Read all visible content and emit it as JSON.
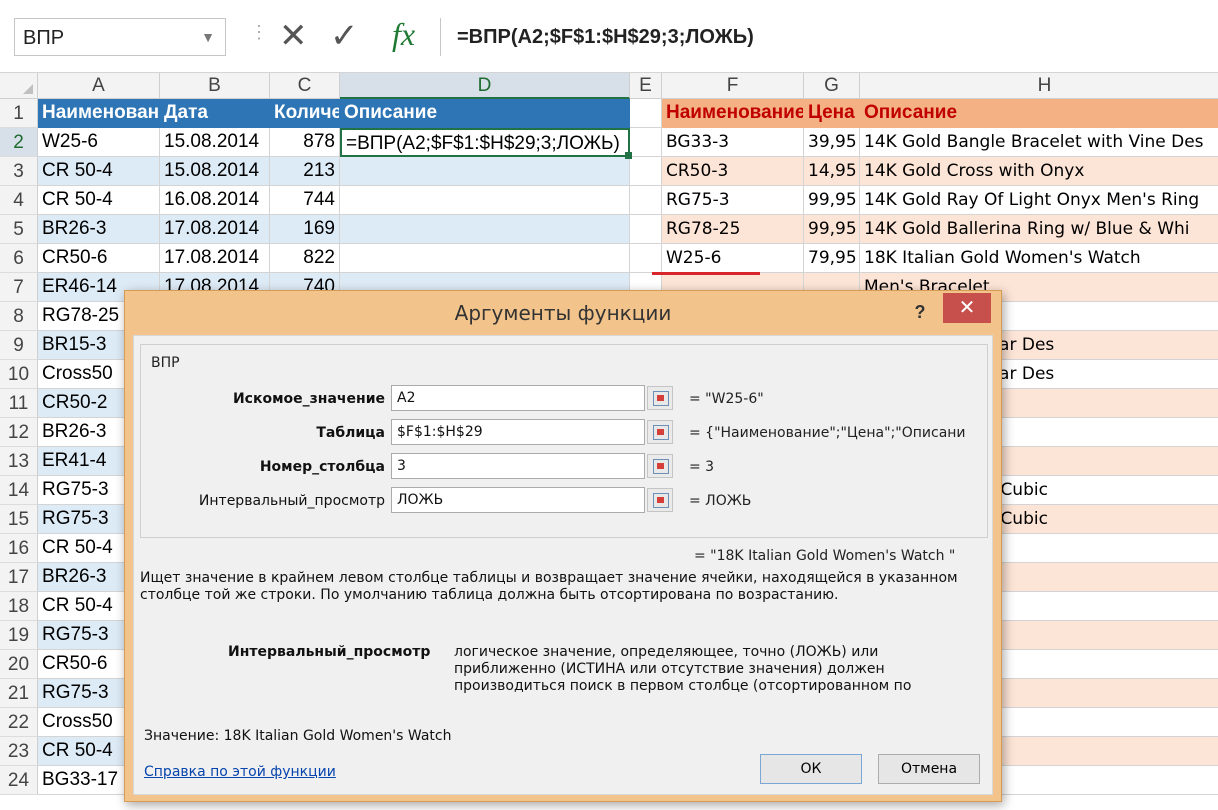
{
  "formula_bar": {
    "name_box": "ВПР",
    "cancel_icon": "✕",
    "enter_icon": "✓",
    "fx_label": "fx",
    "formula": "=ВПР(A2;$F$1:$H$29;3;ЛОЖЬ)"
  },
  "columns": [
    "A",
    "B",
    "C",
    "D",
    "E",
    "F",
    "G",
    "H"
  ],
  "rows": [
    {
      "n": "1",
      "a": "Наименование",
      "b": "Дата",
      "c": "Количество",
      "d": "Описание",
      "f": "Наименование",
      "g": "Цена",
      "h": "Описание"
    },
    {
      "n": "2",
      "a": "W25-6",
      "b": "15.08.2014",
      "c": "878",
      "d": "=ВПР(A2;$F$1:$H$29;3;ЛОЖЬ)",
      "f": "BG33-3",
      "g": "39,95",
      "h": "14K Gold Bangle Bracelet with Vine Des"
    },
    {
      "n": "3",
      "a": "CR 50-4",
      "b": "15.08.2014",
      "c": "213",
      "f": "CR50-3",
      "g": "14,95",
      "h": "14K Gold Cross with Onyx"
    },
    {
      "n": "4",
      "a": "CR 50-4",
      "b": "16.08.2014",
      "c": "744",
      "f": "RG75-3",
      "g": "99,95",
      "h": "14K Gold Ray Of Light Onyx Men's Ring"
    },
    {
      "n": "5",
      "a": "BR26-3",
      "b": "17.08.2014",
      "c": "169",
      "f": "RG78-25",
      "g": "99,95",
      "h": "14K Gold Ballerina Ring w/ Blue & Whi"
    },
    {
      "n": "6",
      "a": "CR50-6",
      "b": "17.08.2014",
      "c": "822",
      "f": "W25-6",
      "g": "79,95",
      "h": "18K Italian Gold Women's Watch"
    },
    {
      "n": "7",
      "a": "ER46-14",
      "b": "17.08.2014",
      "c": "740",
      "h": "Men's Bracelet"
    },
    {
      "n": "8",
      "a": "RG78-25",
      "h": "Men's Bracelet"
    },
    {
      "n": "9",
      "a": "BR15-3",
      "h": "Bracelet with Star Des"
    },
    {
      "n": "10",
      "a": "Cross50",
      "h": "Bracelet with Star Des"
    },
    {
      "n": "11",
      "a": "CR50-2",
      "h": "ross"
    },
    {
      "n": "12",
      "a": "BR26-3",
      "h": "ross"
    },
    {
      "n": "13",
      "a": "ER41-4",
      "h": "ross"
    },
    {
      "n": "14",
      "a": "RG75-3",
      "h": "ross with White Cubic"
    },
    {
      "n": "15",
      "a": "RG75-3",
      "h": "ross with White Cubic"
    },
    {
      "n": "16",
      "a": "CR 50-4",
      "h": "ut Earrings"
    },
    {
      "n": "17",
      "a": "BR26-3",
      "h": "op Earrings"
    },
    {
      "n": "18",
      "a": "CR 50-4",
      "h": "Earrings"
    },
    {
      "n": "19",
      "a": "RG75-3",
      "h": "arrings"
    },
    {
      "n": "20",
      "a": "CR50-6",
      "h": "s"
    },
    {
      "n": "21",
      "a": "RG75-3",
      "h": "arrings"
    },
    {
      "n": "22",
      "a": "Cross50",
      "h": "Earrings"
    },
    {
      "n": "23",
      "a": "CR 50-4",
      "h": "ube Earrings"
    },
    {
      "n": "24",
      "a": "BG33-17",
      "h": "ube Earrings"
    }
  ],
  "dialog": {
    "title": "Аргументы функции",
    "help": "?",
    "close": "✕",
    "function_name": "ВПР",
    "args": [
      {
        "label": "Искомое_значение",
        "value": "A2",
        "result": "=  \"W25-6\""
      },
      {
        "label": "Таблица",
        "value": "$F$1:$H$29",
        "result": "=  {\"Наименование\";\"Цена\";\"Описани"
      },
      {
        "label": "Номер_столбца",
        "value": "3",
        "result": "=  3"
      },
      {
        "label": "Интервальный_просмотр",
        "value": "ЛОЖЬ",
        "result": "=  ЛОЖЬ"
      }
    ],
    "formula_result": "=  \"18K Italian Gold Women's Watch \"",
    "description": "Ищет значение в крайнем левом столбце таблицы и возвращает значение ячейки, находящейся в указанном столбце той же строки. По умолчанию таблица должна быть отсортирована по возрастанию.",
    "arg_name": "Интервальный_просмотр",
    "arg_description": "логическое значение, определяющее, точно (ЛОЖЬ) или приближенно (ИСТИНА или отсутствие значения) должен производиться поиск в первом столбце (отсортированном по",
    "value_text": "Значение:   18K Italian Gold Women's Watch",
    "help_link": "Справка по этой функции",
    "ok": "ОК",
    "cancel": "Отмена"
  },
  "colors": {
    "header_blue": "#2e75b6",
    "header_orange": "#f4b183",
    "band_blue": "#ddebf7",
    "band_peach": "#fce4d6",
    "dialog_frame": "#f2c48b",
    "close_red": "#c7504c",
    "accent_green": "#217346"
  }
}
